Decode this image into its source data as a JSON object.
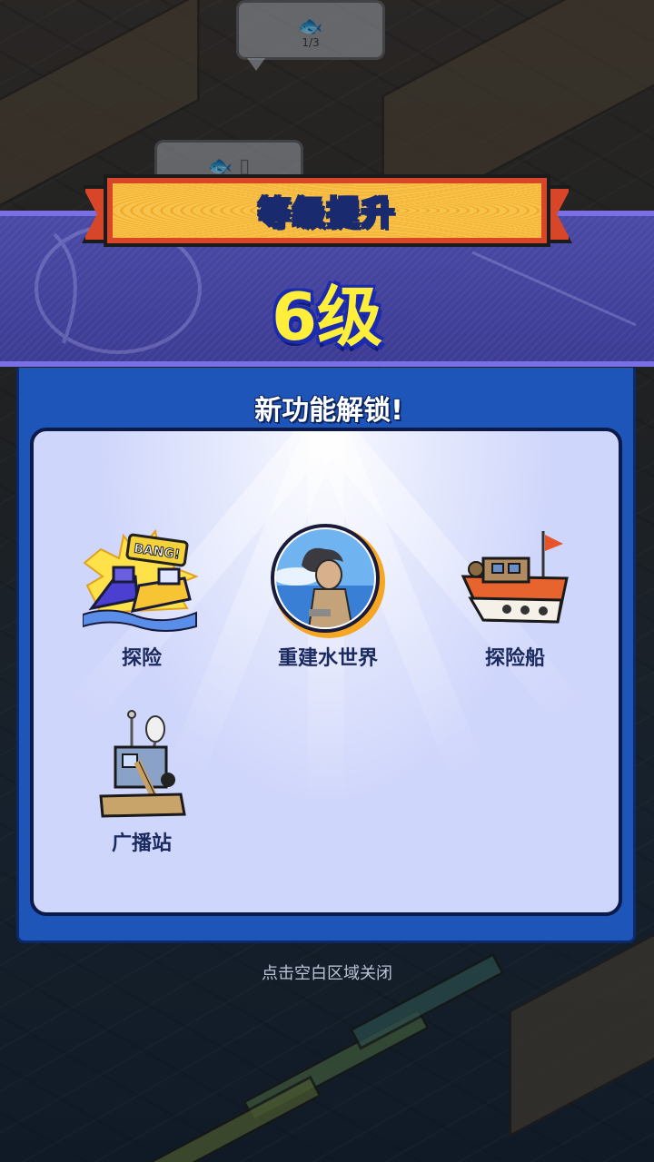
{
  "speech_bubbles": [
    {
      "text": "1/3"
    }
  ],
  "banner": {
    "title": "等级提升",
    "level": "6级"
  },
  "unlock_panel": {
    "title": "新功能解锁!",
    "features": [
      {
        "label": "探险",
        "icon": "bang-boats-icon"
      },
      {
        "label": "重建水世界",
        "icon": "survivor-portrait-icon"
      },
      {
        "label": "探险船",
        "icon": "expedition-ship-icon"
      },
      {
        "label": "广播站",
        "icon": "radio-station-icon"
      }
    ]
  },
  "footer": {
    "hint": "点击空白区域关闭"
  },
  "colors": {
    "band": "#4a4aa6",
    "panel": "#1d55b8",
    "level_text": "#ffef3a",
    "ribbon": "#f4b73a"
  }
}
